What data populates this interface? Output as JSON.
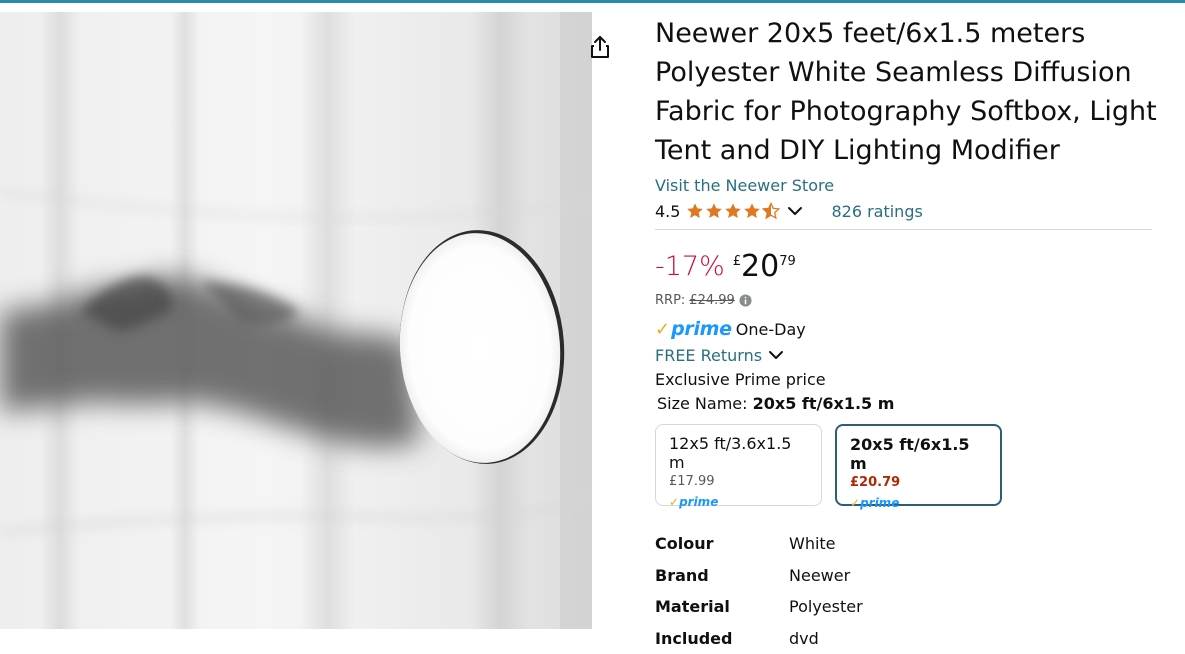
{
  "product": {
    "title": "Neewer 20x5 feet/6x1.5 meters Polyester White Seamless Diffusion Fabric for Photography Softbox, Light Tent and DIY Lighting Modifier",
    "store_link": "Visit the Neewer Store",
    "rating_value": "4.5",
    "rating_stars": 4.5,
    "rating_count": "826 ratings"
  },
  "pricing": {
    "discount": "-17%",
    "currency": "£",
    "whole": "20",
    "fraction": "79",
    "rrp_label": "RRP:",
    "rrp_value": "£24.99"
  },
  "delivery": {
    "prime_word": "prime",
    "prime_label": "One-Day",
    "returns": "FREE Returns",
    "exclusive": "Exclusive Prime price"
  },
  "size": {
    "label": "Size Name:",
    "selected": "20x5 ft/6x1.5 m",
    "options": [
      {
        "name": "12x5 ft/3.6x1.5 m",
        "price": "£17.99",
        "prime": "prime"
      },
      {
        "name": "20x5 ft/6x1.5 m",
        "price": "£20.79",
        "prime": "prime"
      }
    ]
  },
  "specs": [
    {
      "key": "Colour",
      "value": "White"
    },
    {
      "key": "Brand",
      "value": "Neewer"
    },
    {
      "key": "Material",
      "value": "Polyester"
    },
    {
      "key": "Included",
      "value": "dvd"
    }
  ],
  "colors": {
    "link": "#2a6f80",
    "discount": "#cc0c39",
    "star": "#de7921",
    "prime_blue": "#1a98ff",
    "prime_check": "#f5a623",
    "selected_border": "#2b5f73",
    "selected_price": "#b12704"
  },
  "icons": {
    "share": "share-icon",
    "chevron": "chevron-down-icon",
    "info": "info-icon",
    "star": "star-icon"
  }
}
